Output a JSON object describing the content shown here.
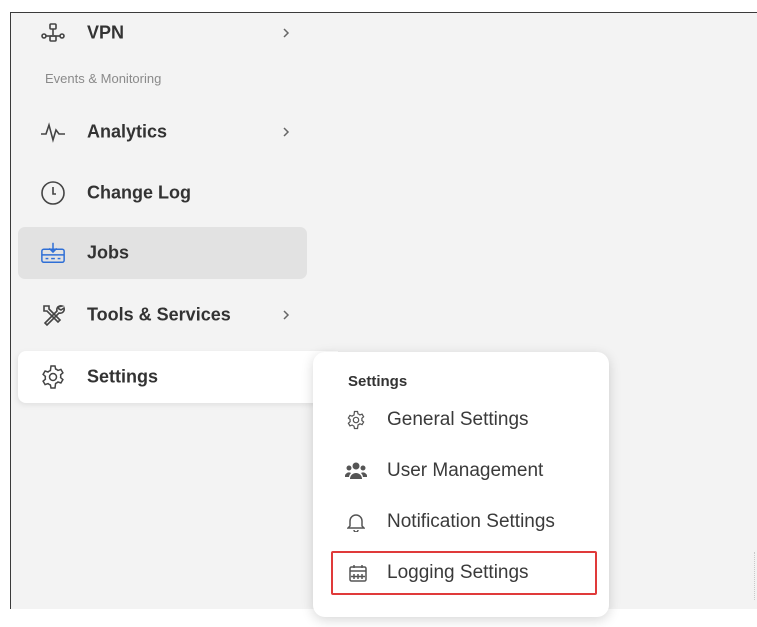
{
  "sidebar": {
    "items": [
      {
        "label": "VPN",
        "icon": "network-icon",
        "has_submenu": true
      },
      {
        "label": "Analytics",
        "icon": "pulse-icon",
        "has_submenu": true
      },
      {
        "label": "Change Log",
        "icon": "clock-icon",
        "has_submenu": false
      },
      {
        "label": "Jobs",
        "icon": "jobs-tray-icon",
        "has_submenu": false,
        "active": true
      },
      {
        "label": "Tools & Services",
        "icon": "tools-icon",
        "has_submenu": true
      },
      {
        "label": "Settings",
        "icon": "gear-icon",
        "has_submenu": true,
        "expanded": true
      }
    ],
    "section_label": "Events & Monitoring"
  },
  "flyout": {
    "title": "Settings",
    "items": [
      {
        "label": "General Settings",
        "icon": "gear-icon"
      },
      {
        "label": "User Management",
        "icon": "users-icon"
      },
      {
        "label": "Notification Settings",
        "icon": "bell-icon"
      },
      {
        "label": "Logging Settings",
        "icon": "calendar-icon",
        "highlighted": true
      }
    ]
  },
  "colors": {
    "content_bg": "#f3f3f3",
    "active_item_bg": "#e2e2e2",
    "highlight_border": "#e03a3a",
    "text": "#333333",
    "muted_text": "#8a8a8a"
  }
}
